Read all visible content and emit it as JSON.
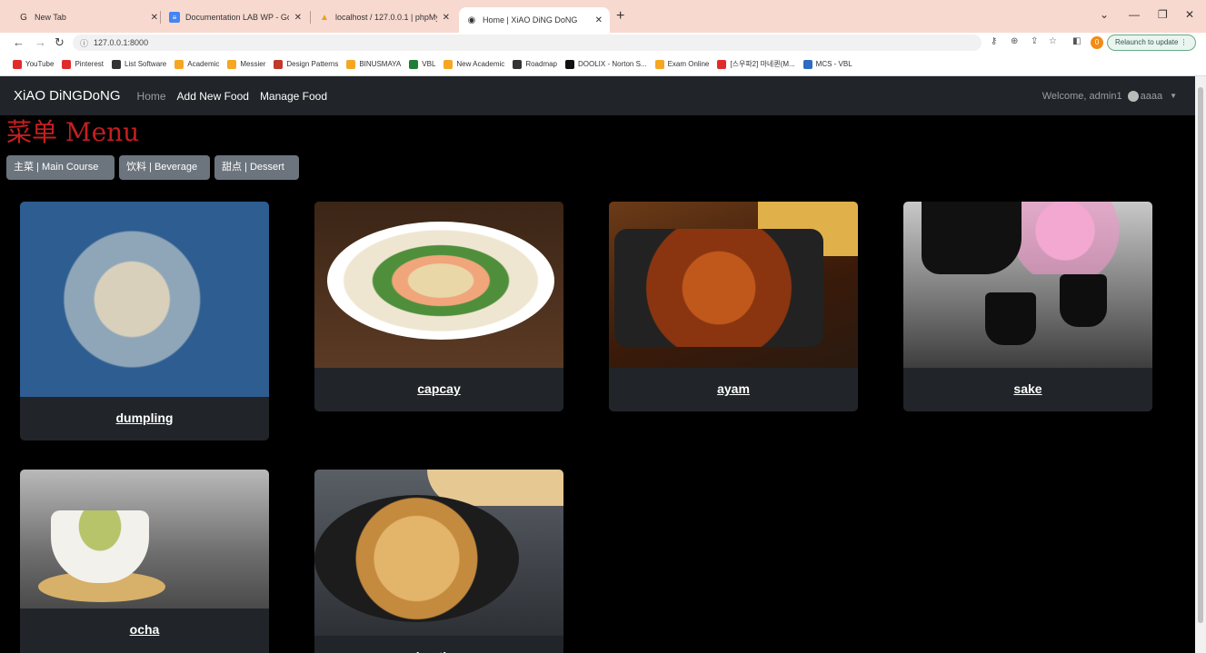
{
  "browser": {
    "tabs": [
      {
        "title": "New Tab"
      },
      {
        "title": "Documentation LAB WP - Goo..."
      },
      {
        "title": "localhost / 127.0.0.1 | phpMyAd..."
      },
      {
        "title": "Home | XiAO DiNG DoNG",
        "active": true
      }
    ],
    "url": "127.0.0.1:8000",
    "relaunch_label": "Relaunch to update",
    "profile_initial": "0",
    "bookmarks": [
      {
        "label": "YouTube",
        "color": "#e02b2b"
      },
      {
        "label": "Pinterest",
        "color": "#e02b2b"
      },
      {
        "label": "List Software",
        "color": "#333333"
      },
      {
        "label": "Academic",
        "color": "#f5a623"
      },
      {
        "label": "Messier",
        "color": "#f5a623"
      },
      {
        "label": "Design Patterns",
        "color": "#c0392b"
      },
      {
        "label": "BINUSMAYA",
        "color": "#f5a623"
      },
      {
        "label": "VBL",
        "color": "#1e7e34"
      },
      {
        "label": "New Academic",
        "color": "#f5a623"
      },
      {
        "label": "Roadmap",
        "color": "#333333"
      },
      {
        "label": "DOOLIX - Norton S...",
        "color": "#111111"
      },
      {
        "label": "Exam Online",
        "color": "#f5a623"
      },
      {
        "label": "[스우파2] 마네퀸(M...",
        "color": "#e02b2b"
      },
      {
        "label": "MCS - VBL",
        "color": "#2d6cc0"
      }
    ]
  },
  "navbar": {
    "brand": "XiAO DiNGDoNG",
    "links": [
      "Home",
      "Add New Food",
      "Manage Food"
    ],
    "welcome": "Welcome, admin1",
    "user": "aaaa"
  },
  "page": {
    "title": "菜单 Menu",
    "categories": [
      "主菜 | Main Course",
      "饮料 | Beverage",
      "甜点 | Dessert"
    ]
  },
  "foods": [
    {
      "name": "dumpling"
    },
    {
      "name": "capcay"
    },
    {
      "name": "ayam"
    },
    {
      "name": "sake"
    },
    {
      "name": "ocha"
    },
    {
      "name": "bapting"
    }
  ],
  "colors": {
    "navbar_bg": "#212529",
    "title_red": "#c41f1f",
    "button_gray": "#6c757d",
    "card_bg": "#212529"
  }
}
